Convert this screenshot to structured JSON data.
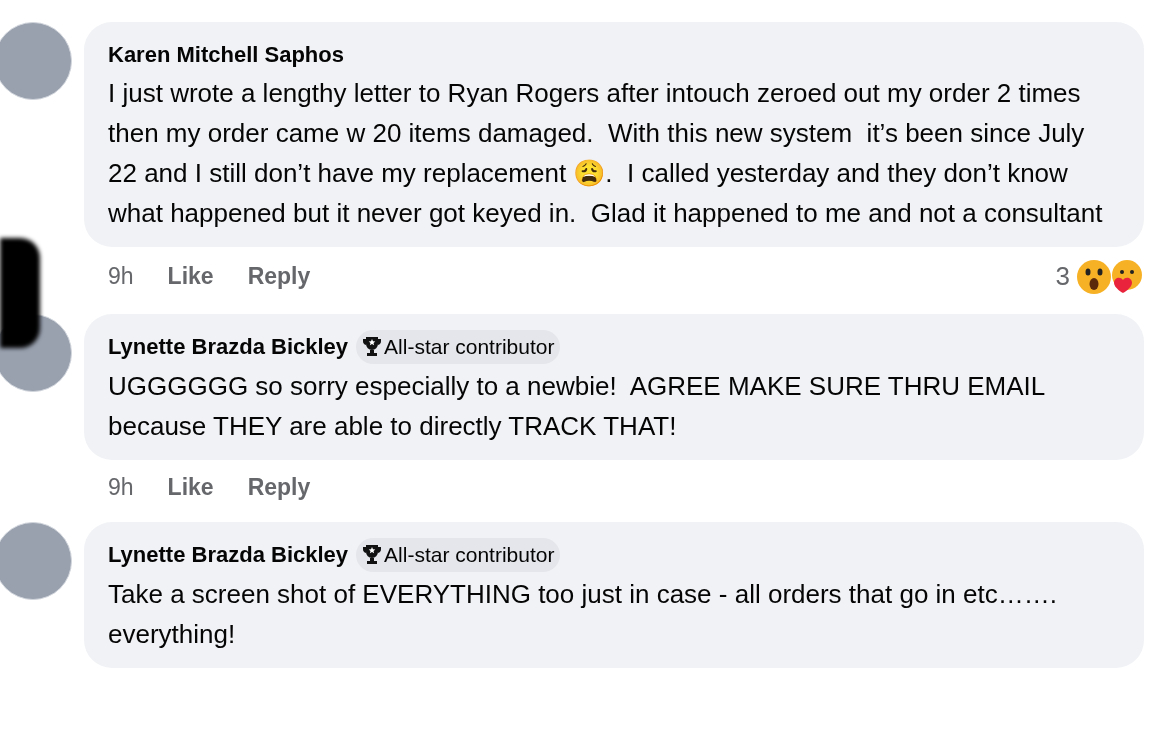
{
  "comments": [
    {
      "author": "Karen Mitchell Saphos",
      "text": "I just wrote a lengthy letter to Ryan Rogers after intouch zeroed out my order 2 times then my order came w 20 items damaged.  With this new system  it’s been since July 22 and I still don’t have my replacement 😩.  I called yesterday and they don’t know what happened but it never got keyed in.  Glad it happened to me and not a consultant",
      "time": "9h",
      "actions": [
        "Like",
        "Reply"
      ],
      "reaction_count": "3",
      "reactions": [
        {
          "kind": "wow"
        },
        {
          "kind": "care"
        }
      ]
    },
    {
      "author": "Lynette Brazda Bickley",
      "badge": "All-star contributor",
      "text": "UGGGGGG so sorry especially to a newbie!  AGREE MAKE SURE THRU EMAIL because THEY are able to directly TRACK THAT!",
      "time": "9h",
      "actions": [
        "Like",
        "Reply"
      ]
    },
    {
      "author": "Lynette Brazda Bickley",
      "badge": "All-star contributor",
      "text": "Take a screen shot of EVERYTHING too just in case - all orders that go in etc……. everything!"
    }
  ]
}
